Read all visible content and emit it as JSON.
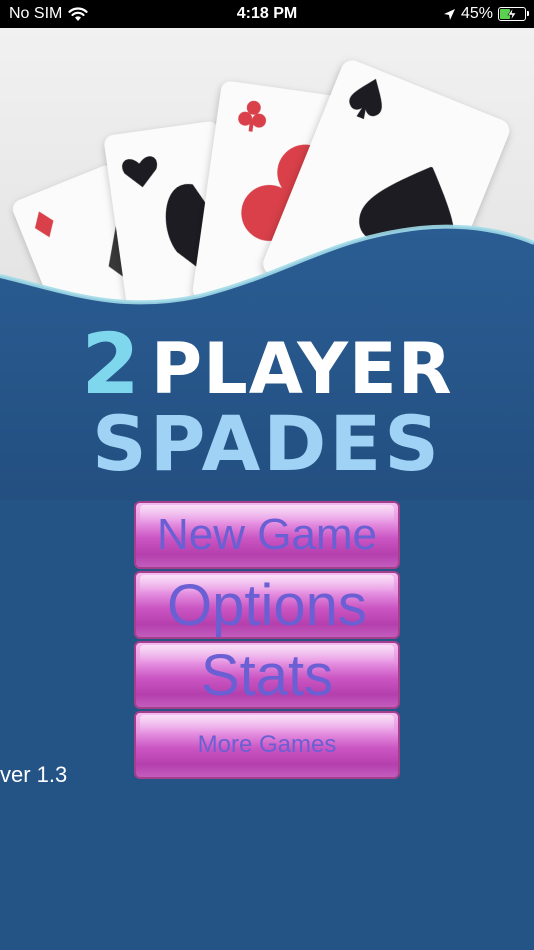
{
  "status_bar": {
    "carrier": "No SIM",
    "time": "4:18 PM",
    "battery_percent": "45%",
    "battery_level": 0.45,
    "icons": [
      "wifi-icon",
      "location-arrow-icon",
      "battery-charging-icon"
    ]
  },
  "logo": {
    "number": "2",
    "word1": "PLAYER",
    "word2": "SPADES"
  },
  "menu": {
    "new_game": "New Game",
    "options": "Options",
    "stats": "Stats",
    "more_games": "More Games"
  },
  "version": "ver 1.3",
  "colors": {
    "background": "#245386",
    "logo_accent": "#7fd7ee",
    "button_purple": "#cb55c3",
    "button_text": "#6b5fd4",
    "suit_red": "#d9414a",
    "suit_black": "#1d1d24"
  }
}
